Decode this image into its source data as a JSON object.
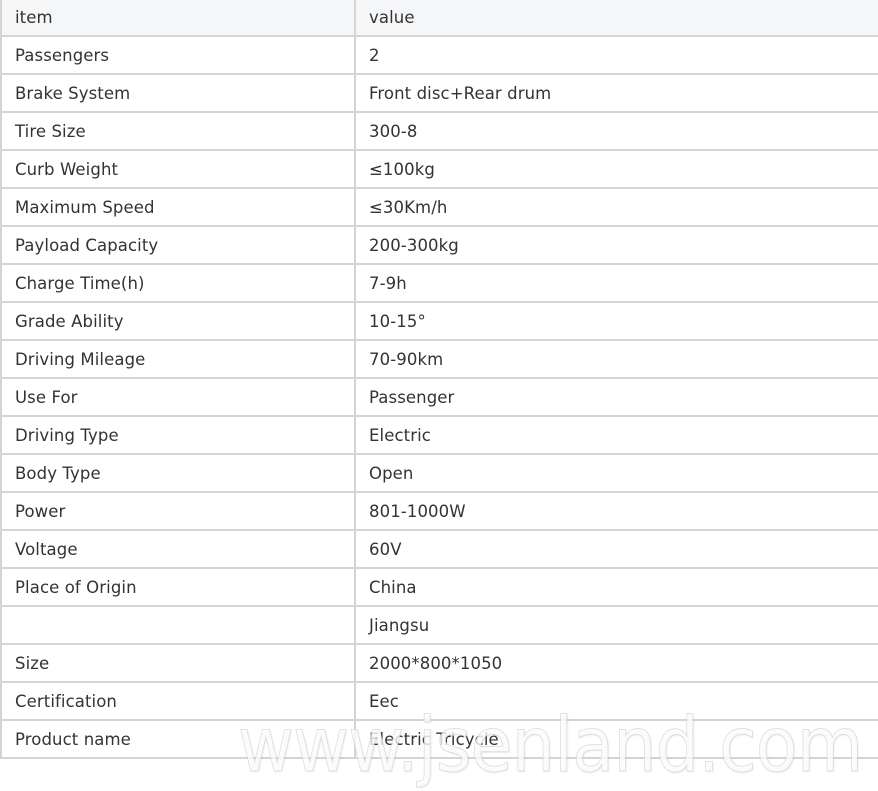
{
  "table": {
    "headers": {
      "item": "item",
      "value": "value"
    },
    "rows": [
      {
        "item": "Passengers",
        "value": "2"
      },
      {
        "item": "Brake System",
        "value": "Front disc+Rear drum"
      },
      {
        "item": "Tire Size",
        "value": "300-8"
      },
      {
        "item": "Curb Weight",
        "value": "≤100kg"
      },
      {
        "item": "Maximum Speed",
        "value": "≤30Km/h"
      },
      {
        "item": "Payload Capacity",
        "value": "200-300kg"
      },
      {
        "item": "Charge Time(h)",
        "value": "7-9h"
      },
      {
        "item": "Grade Ability",
        "value": "10-15°"
      },
      {
        "item": "Driving Mileage",
        "value": "70-90km"
      },
      {
        "item": "Use For",
        "value": "Passenger"
      },
      {
        "item": "Driving Type",
        "value": "Electric"
      },
      {
        "item": "Body Type",
        "value": "Open"
      },
      {
        "item": "Power",
        "value": "801-1000W"
      },
      {
        "item": "Voltage",
        "value": "60V"
      },
      {
        "item": "Place of Origin",
        "value": "China"
      },
      {
        "item": "",
        "value": "Jiangsu"
      },
      {
        "item": "Size",
        "value": "2000*800*1050"
      },
      {
        "item": "Certification",
        "value": "Eec"
      },
      {
        "item": "Product name",
        "value": "Electric Tricycle"
      }
    ]
  },
  "watermark": {
    "text": "www.jsenland.com"
  },
  "colors": {
    "header_bg": "#f5f6f8",
    "border": "#d4d4d4",
    "text": "#333333"
  }
}
